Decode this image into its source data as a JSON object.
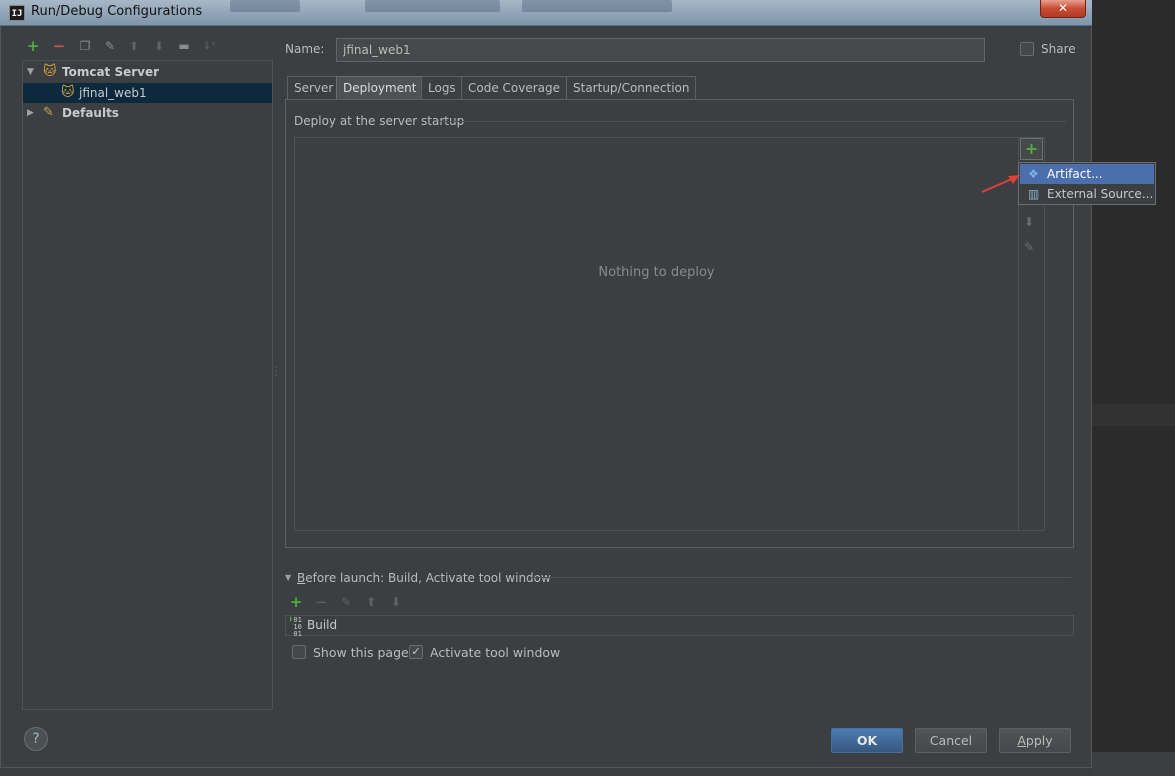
{
  "window": {
    "title": "Run/Debug Configurations",
    "app_icon_text": "IJ",
    "close_label": "✕"
  },
  "left_toolbar": {
    "icons": [
      "add-icon",
      "remove-icon",
      "copy-icon",
      "edit-defaults-icon",
      "move-up-icon",
      "move-down-icon",
      "folder-icon",
      "sort-icon"
    ]
  },
  "tree": {
    "items": [
      {
        "label": "Tomcat Server",
        "expanded": true,
        "icon": "tomcat-icon"
      },
      {
        "label": "jfinal_web1",
        "selected": true,
        "icon": "tomcat-config-icon"
      },
      {
        "label": "Defaults",
        "expanded": false,
        "icon": "defaults-icon"
      }
    ]
  },
  "config": {
    "name_label": "Name:",
    "name_value": "jfinal_web1",
    "share_label": "Share",
    "share_checked": false
  },
  "tabs": [
    {
      "label": "Server",
      "active": false
    },
    {
      "label": "Deployment",
      "active": true
    },
    {
      "label": "Logs",
      "active": false
    },
    {
      "label": "Code Coverage",
      "active": false
    },
    {
      "label": "Startup/Connection",
      "active": false
    }
  ],
  "deployment": {
    "header": "Deploy at the server startup",
    "empty_text": "Nothing to deploy",
    "add_label": "+"
  },
  "popup_menu": {
    "items": [
      {
        "label": "Artifact...",
        "icon": "artifact-icon",
        "highlighted": true
      },
      {
        "label": "External Source...",
        "icon": "external-source-icon",
        "highlighted": false
      }
    ]
  },
  "before_launch": {
    "label": "Before launch: Build, Activate tool window",
    "build_icon_text": "01\n10\n01",
    "items": [
      {
        "label": "Build"
      }
    ],
    "show_page_label": "Show this page",
    "show_page_checked": false,
    "activate_label": "Activate tool window",
    "activate_checked": true
  },
  "buttons": {
    "help": "?",
    "ok": "OK",
    "cancel": "Cancel",
    "apply": "Apply"
  },
  "colors": {
    "panel_bg": "#3c3f41",
    "selection": "#0d293e",
    "menu_highlight": "#4b6eaf",
    "ok_button": "#365880",
    "add_green": "#4fae3f",
    "arrow_red": "#e0403a"
  }
}
